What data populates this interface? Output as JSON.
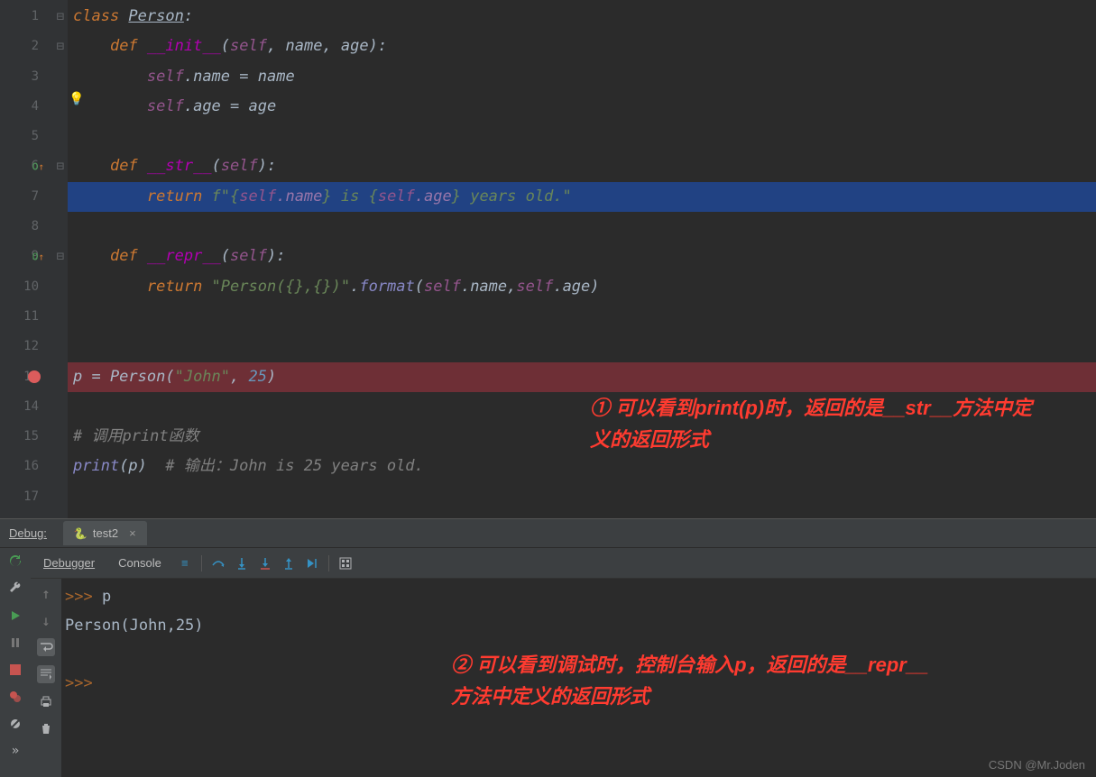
{
  "gutter": {
    "numbers": [
      "1",
      "2",
      "3",
      "4",
      "5",
      "6",
      "7",
      "8",
      "9",
      "10",
      "11",
      "12",
      "13",
      "14",
      "15",
      "16",
      "17"
    ]
  },
  "code": {
    "l1_1": "class ",
    "l1_2": "Person",
    "l1_3": ":",
    "l2_1": "    ",
    "l2_2": "def ",
    "l2_3": "__init__",
    "l2_4": "(",
    "l2_5": "self",
    "l2_6": ", ",
    "l2_7": "name",
    "l2_8": ", ",
    "l2_9": "age",
    "l2_10": "):",
    "l3_1": "        ",
    "l3_2": "self",
    "l3_3": ".name = ",
    "l3_4": "name",
    "l4_1": "        ",
    "l4_2": "self",
    "l4_3": ".age = ",
    "l4_4": "age",
    "l6_1": "    ",
    "l6_2": "def ",
    "l6_3": "__str__",
    "l6_4": "(",
    "l6_5": "self",
    "l6_6": "):",
    "l7_1": "        ",
    "l7_2": "return ",
    "l7_3": "f\"{",
    "l7_4": "self",
    "l7_5": ".name",
    "l7_6": "} is {",
    "l7_7": "self",
    "l7_8": ".age",
    "l7_9": "} years old.\"",
    "l9_1": "    ",
    "l9_2": "def ",
    "l9_3": "__repr__",
    "l9_4": "(",
    "l9_5": "self",
    "l9_6": "):",
    "l10_1": "        ",
    "l10_2": "return ",
    "l10_3": "\"Person({},{})\"",
    "l10_4": ".",
    "l10_5": "format",
    "l10_6": "(",
    "l10_7": "self",
    "l10_8": ".name,",
    "l10_9": "self",
    "l10_10": ".age)",
    "l13_1": "p = Person(",
    "l13_2": "\"John\"",
    "l13_3": ", ",
    "l13_4": "25",
    "l13_5": ")",
    "l15_1": "# 调用print函数",
    "l16_1": "print",
    "l16_2": "(p)  ",
    "l16_3": "# 输出：John is 25 years old."
  },
  "annotations": {
    "a1": "① 可以看到print(p)时，返回的是__str__方法中定义的返回形式",
    "a2": "② 可以看到调试时，控制台输入p，返回的是__repr__方法中定义的返回形式"
  },
  "debug": {
    "label": "Debug:",
    "tab_name": "test2",
    "debugger_tab": "Debugger",
    "console_tab": "Console"
  },
  "console": {
    "prompt1": ">>> ",
    "input1": "p",
    "output1": "Person(John,25)",
    "prompt2": ">>>"
  },
  "watermark": "CSDN @Mr.Joden"
}
